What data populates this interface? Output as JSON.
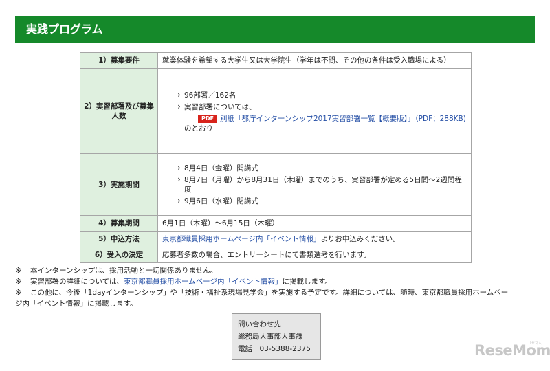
{
  "banner": {
    "title": "実践プログラム"
  },
  "program": {
    "r1_head": "1）募集要件",
    "r1_text": "就業体験を希望する大学生又は大学院生（学年は不問、その他の条件は受入職場による）",
    "r2_head": "2）実習部署及び募集人数",
    "r2_item1": "96部署／162名",
    "r2_item2": "実習部署については、",
    "r2_pdf": "PDF",
    "r2_link": "別紙「都庁インターンシップ2017実習部署一覧【概要版】」（PDF：288KB)",
    "r2_tail": "のとおり",
    "r3_head": "3）実施期間",
    "r3_item1": "8月4日（金曜）開講式",
    "r3_item2": "8月7日（月曜）から8月31日（木曜）までのうち、実習部署が定める5日間〜2週間程度",
    "r3_item3": "9月6日（水曜）閉講式",
    "r4_head": "4）募集期間",
    "r4_text": "6月1日（木曜）〜6月15日（木曜）",
    "r5_head": "5）申込方法",
    "r5_link": "東京都職員採用ホームページ内「イベント情報」",
    "r5_text": "よりお申込みください。",
    "r6_head": "6）受入の決定",
    "r6_text": "応募者多数の場合、エントリーシートにて書類選考を行います。"
  },
  "notes": {
    "mark": "※",
    "n1": "本インターンシップは、採用活動と一切関係ありません。",
    "n2_pre": "実習部署の詳細については、",
    "n2_link": "東京都職員採用ホームページ内「イベント情報」",
    "n2_post": "に掲載します。",
    "n3_line1": "この他に、今後「1dayインターンシップ」や「技術・福祉系現場見学会」を実施する予定です。詳細については、随時、東京都職員採用ホームペー",
    "n3_line2": "ジ内「イベント情報」に掲載します。"
  },
  "contact": {
    "label": "問い合わせ先",
    "dept": "総務局人事部人事課",
    "tel": "電話　03-5388-2375"
  },
  "watermark": {
    "logo": "ReseMom",
    "sub": "リセマム"
  }
}
